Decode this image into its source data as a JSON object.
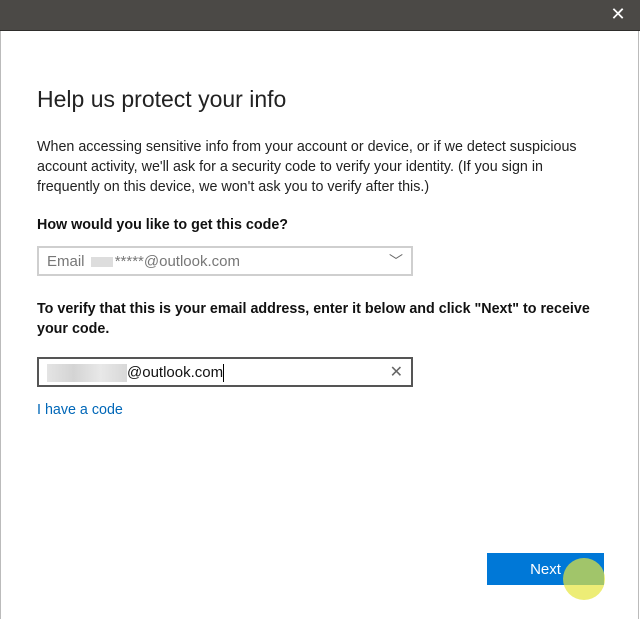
{
  "window": {
    "close_icon": "close-icon"
  },
  "title": "Help us protect your info",
  "description": "When accessing sensitive info from your account or device, or if we detect suspicious account activity, we'll ask for a security code to verify your identity. (If you sign in frequently on this device, we won't ask you to verify after this.)",
  "method_question": "How would you like to get this code?",
  "method_select": {
    "prefix": "Email",
    "value": "*****@outlook.com"
  },
  "verify_prompt": "To verify that this is your email address, enter it below and click \"Next\" to receive your code.",
  "email_input": {
    "value": "@outlook.com"
  },
  "have_code_link": "I have a code",
  "next_button": "Next",
  "colors": {
    "accent": "#0078d7",
    "link": "#0067b8",
    "titlebar": "#4b4946"
  }
}
